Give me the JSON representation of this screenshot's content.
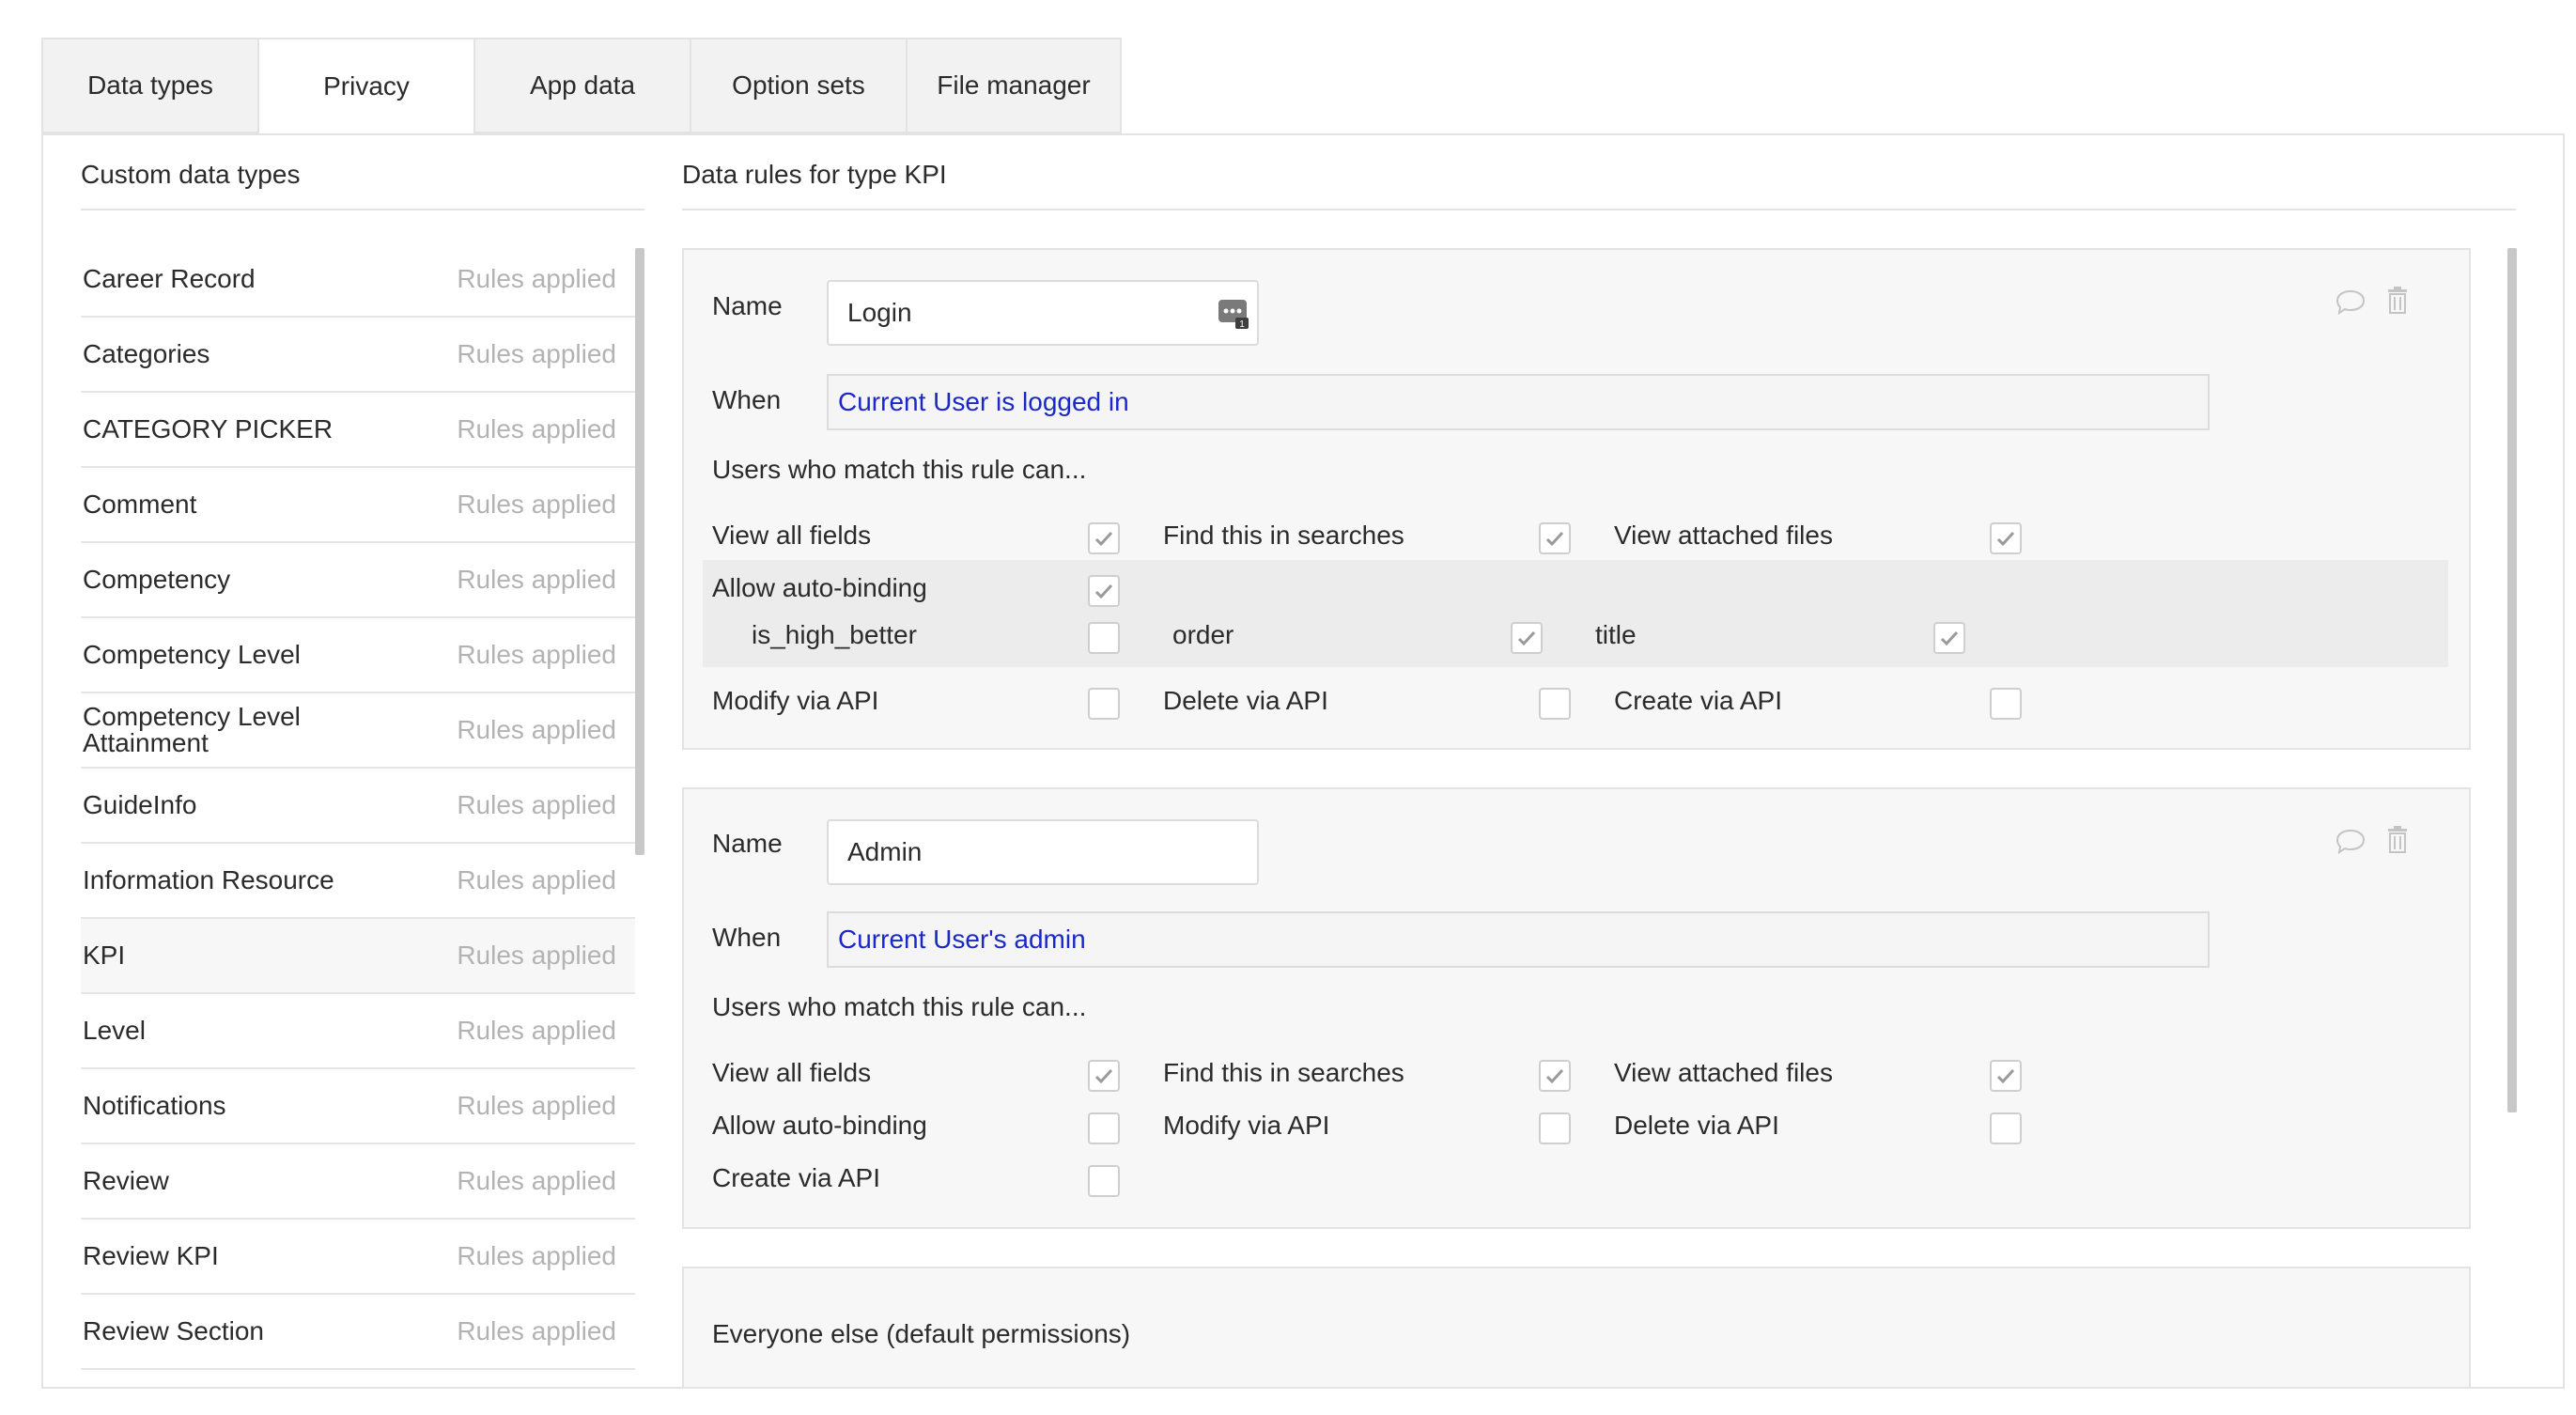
{
  "tabs": [
    {
      "label": "Data types"
    },
    {
      "label": "Privacy"
    },
    {
      "label": "App data"
    },
    {
      "label": "Option sets"
    },
    {
      "label": "File manager"
    }
  ],
  "left_panel": {
    "title": "Custom data types",
    "items": [
      {
        "name": "Career Record",
        "status": "Rules applied"
      },
      {
        "name": "Categories",
        "status": "Rules applied"
      },
      {
        "name": "CATEGORY PICKER",
        "status": "Rules applied"
      },
      {
        "name": "Comment",
        "status": "Rules applied"
      },
      {
        "name": "Competency",
        "status": "Rules applied"
      },
      {
        "name": "Competency Level",
        "status": "Rules applied"
      },
      {
        "name": "Competency Level Attainment",
        "status": "Rules applied"
      },
      {
        "name": "GuideInfo",
        "status": "Rules applied"
      },
      {
        "name": "Information Resource",
        "status": "Rules applied"
      },
      {
        "name": "KPI",
        "status": "Rules applied",
        "selected": true
      },
      {
        "name": "Level",
        "status": "Rules applied"
      },
      {
        "name": "Notifications",
        "status": "Rules applied"
      },
      {
        "name": "Review",
        "status": "Rules applied"
      },
      {
        "name": "Review KPI",
        "status": "Rules applied"
      },
      {
        "name": "Review Section",
        "status": "Rules applied"
      }
    ]
  },
  "right_panel": {
    "title": "Data rules for type KPI",
    "rules": [
      {
        "name_label": "Name",
        "name_value": "Login",
        "when_label": "When",
        "when_value": "Current User is logged in",
        "users_label": "Users who match this rule can...",
        "perm_view_all_fields": {
          "label": "View all fields",
          "checked": true
        },
        "perm_find_in_searches": {
          "label": "Find this in searches",
          "checked": true
        },
        "perm_view_attached_files": {
          "label": "View attached files",
          "checked": true
        },
        "perm_allow_auto_binding": {
          "label": "Allow auto-binding",
          "checked": true
        },
        "field_is_high_better": {
          "label": "is_high_better",
          "checked": false
        },
        "field_order": {
          "label": "order",
          "checked": true
        },
        "field_title": {
          "label": "title",
          "checked": true
        },
        "perm_modify_api": {
          "label": "Modify via API",
          "checked": false
        },
        "perm_delete_api": {
          "label": "Delete via API",
          "checked": false
        },
        "perm_create_api": {
          "label": "Create via API",
          "checked": false
        }
      },
      {
        "name_label": "Name",
        "name_value": "Admin",
        "when_label": "When",
        "when_value": "Current User's admin",
        "users_label": "Users who match this rule can...",
        "perm_view_all_fields": {
          "label": "View all fields",
          "checked": true
        },
        "perm_find_in_searches": {
          "label": "Find this in searches",
          "checked": true
        },
        "perm_view_attached_files": {
          "label": "View attached files",
          "checked": true
        },
        "perm_allow_auto_binding": {
          "label": "Allow auto-binding",
          "checked": false
        },
        "perm_modify_api": {
          "label": "Modify via API",
          "checked": false
        },
        "perm_delete_api": {
          "label": "Delete via API",
          "checked": false
        },
        "perm_create_api": {
          "label": "Create via API",
          "checked": false
        }
      }
    ],
    "default_label": "Everyone else (default permissions)"
  },
  "icons": {
    "comment": "comment-icon",
    "trash": "trash-icon",
    "dynamic_data": "dynamic-data-icon",
    "check": "check-icon"
  },
  "colors": {
    "expression_text": "#1a28c9",
    "checkmark": "#9a9a9a",
    "muted_text": "#b3b3b3"
  }
}
